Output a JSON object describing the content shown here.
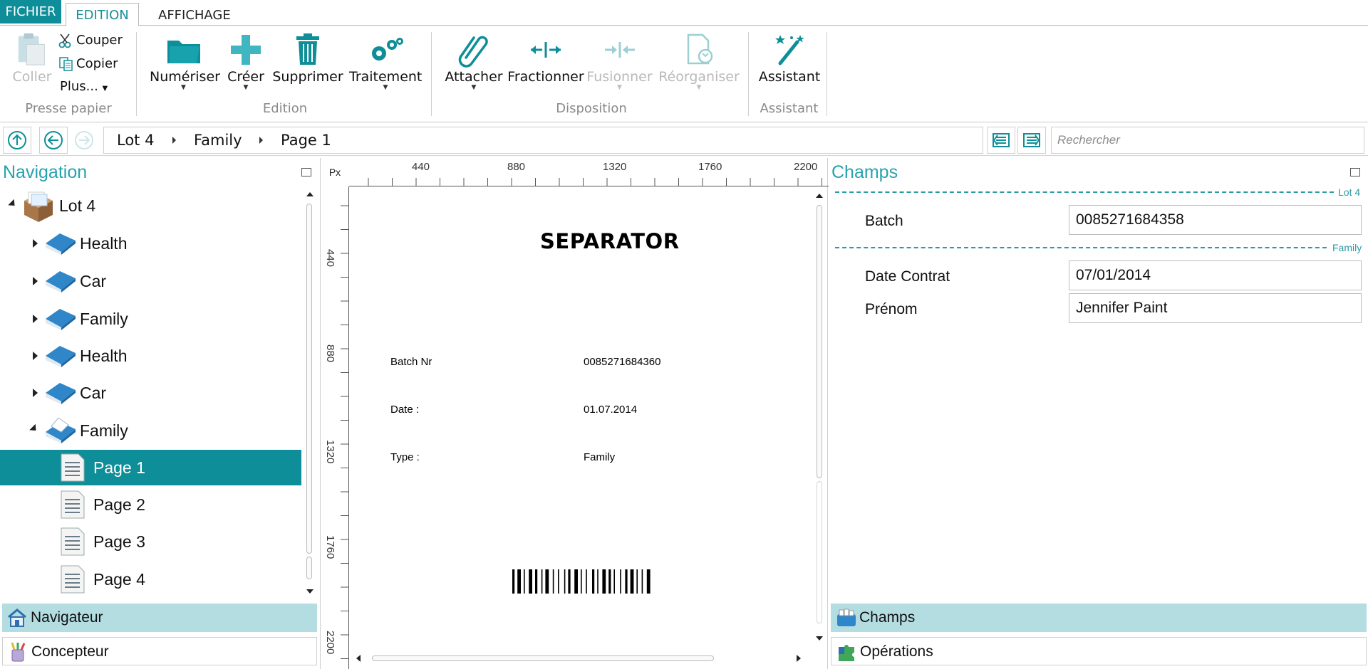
{
  "tabs": {
    "file": "FICHIER",
    "edit": "EDITION",
    "view": "AFFICHAGE"
  },
  "ribbon": {
    "clipboard": {
      "paste": "Coller",
      "cut": "Couper",
      "copy": "Copier",
      "more": "Plus...",
      "group_label": "Presse papier"
    },
    "edition": {
      "scan": "Numériser",
      "create": "Créer",
      "delete": "Supprimer",
      "process": "Traitement",
      "group_label": "Edition"
    },
    "layout": {
      "attach": "Attacher",
      "split": "Fractionner",
      "merge": "Fusionner",
      "reorganize": "Réorganiser",
      "group_label": "Disposition"
    },
    "assistant": {
      "assistant": "Assistant",
      "group_label": "Assistant"
    }
  },
  "breadcrumb": {
    "items": [
      "Lot 4",
      "Family",
      "Page 1"
    ],
    "search_placeholder": "Rechercher"
  },
  "navigation": {
    "title": "Navigation",
    "tree": [
      {
        "label": "Lot 4",
        "icon": "batch-box-icon",
        "expanded": true
      },
      {
        "label": "Health",
        "icon": "book-icon",
        "expanded": false
      },
      {
        "label": "Car",
        "icon": "book-icon",
        "expanded": false
      },
      {
        "label": "Family",
        "icon": "book-icon",
        "expanded": false
      },
      {
        "label": "Health",
        "icon": "book-icon",
        "expanded": false
      },
      {
        "label": "Car",
        "icon": "book-icon",
        "expanded": false
      },
      {
        "label": "Family",
        "icon": "book-open-icon",
        "expanded": true
      },
      {
        "label": "Page 1",
        "icon": "page-icon",
        "selected": true
      },
      {
        "label": "Page 2",
        "icon": "page-icon"
      },
      {
        "label": "Page 3",
        "icon": "page-icon"
      },
      {
        "label": "Page 4",
        "icon": "page-icon"
      }
    ],
    "dock": {
      "navigator": "Navigateur",
      "designer": "Concepteur"
    }
  },
  "viewer": {
    "ruler_unit": "Px",
    "ruler_top": [
      "440",
      "880",
      "1320",
      "1760",
      "2200"
    ],
    "ruler_left": [
      "440",
      "880",
      "1320",
      "1760",
      "2200"
    ],
    "document": {
      "title": "SEPARATOR",
      "rows": [
        {
          "label": "Batch Nr",
          "value": "0085271684360"
        },
        {
          "label": "Date :",
          "value": "01.07.2014"
        },
        {
          "label": "Type :",
          "value": "Family"
        }
      ]
    }
  },
  "fields": {
    "title": "Champs",
    "groups": [
      {
        "tag": "Lot 4",
        "fields": [
          {
            "label": "Batch",
            "value": "0085271684358"
          }
        ]
      },
      {
        "tag": "Family",
        "fields": [
          {
            "label": "Date Contrat",
            "value": "07/01/2014"
          },
          {
            "label": "Prénom",
            "value": "Jennifer Paint"
          }
        ]
      }
    ],
    "dock": {
      "fields": "Champs",
      "operations": "Opérations"
    }
  },
  "colors": {
    "accent": "#0e8e98",
    "accent_light": "#b4dde2",
    "title_teal": "#27a2ad",
    "disabled": "#b9b9b9"
  }
}
